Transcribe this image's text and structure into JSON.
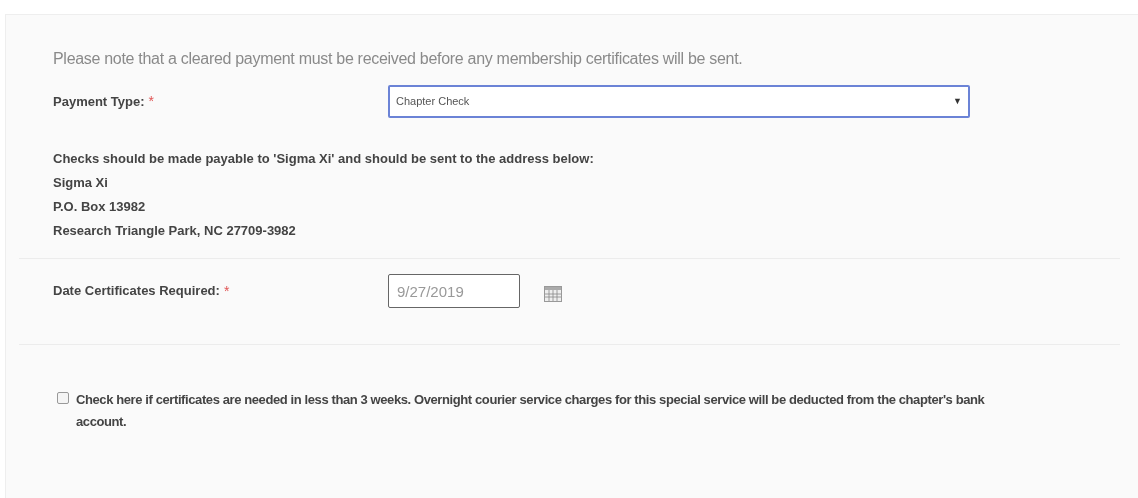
{
  "notice": "Please note that a cleared payment must be received before any membership certificates will be sent.",
  "payment_type": {
    "label": "Payment Type:",
    "required_mark": "*",
    "value": "Chapter Check",
    "arrow": "▼"
  },
  "instructions": [
    "Checks should be made payable to 'Sigma Xi' and should be sent to the address below:",
    "Sigma Xi",
    "P.O. Box 13982",
    "Research Triangle Park, NC 27709-3982"
  ],
  "date_required": {
    "label": "Date Certificates Required:",
    "required_mark": "*",
    "value": "9/27/2019"
  },
  "rush": {
    "label": "Check here if certificates are needed in less than 3 weeks. Overnight courier service charges for this special service will be deducted from the chapter's bank account.",
    "checked": false
  }
}
